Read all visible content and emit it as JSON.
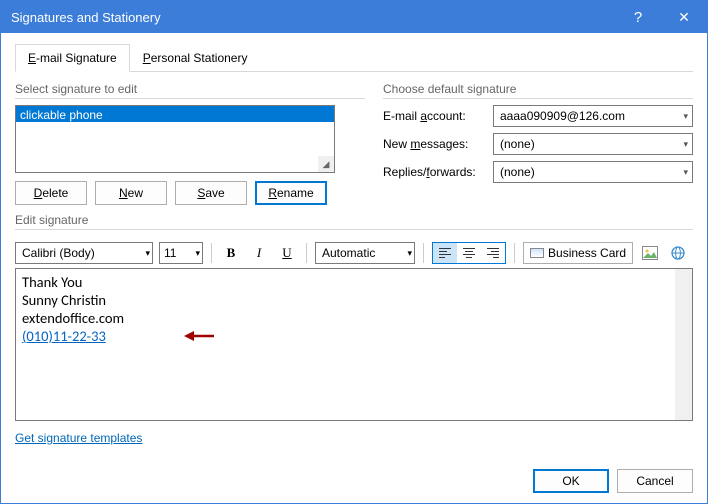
{
  "titlebar": {
    "title": "Signatures and Stationery",
    "help": "?",
    "close": "✕"
  },
  "tabs": {
    "email": "E-mail Signature",
    "personal": "Personal Stationery"
  },
  "select_group_label": "Select signature to edit",
  "sig_list": {
    "items": [
      "clickable phone"
    ]
  },
  "sig_buttons": {
    "delete": "Delete",
    "new": "New",
    "save": "Save",
    "rename": "Rename"
  },
  "defaults_group_label": "Choose default signature",
  "defaults": {
    "email_label": "E-mail account:",
    "email_value": "aaaa090909@126.com",
    "new_label": "New messages:",
    "new_value": "(none)",
    "replies_label": "Replies/forwards:",
    "replies_value": "(none)"
  },
  "edit_group_label": "Edit signature",
  "toolbar": {
    "font": "Calibri (Body)",
    "size": "11",
    "bold": "B",
    "italic": "I",
    "underline": "U",
    "auto": "Automatic",
    "business_card": "Business Card"
  },
  "editor": {
    "line1": "Thank You",
    "line2": "Sunny Christin",
    "line3": "extendoffice.com",
    "phone": "(010)11-22-33"
  },
  "template_link": "Get signature templates",
  "footer": {
    "ok": "OK",
    "cancel": "Cancel"
  }
}
